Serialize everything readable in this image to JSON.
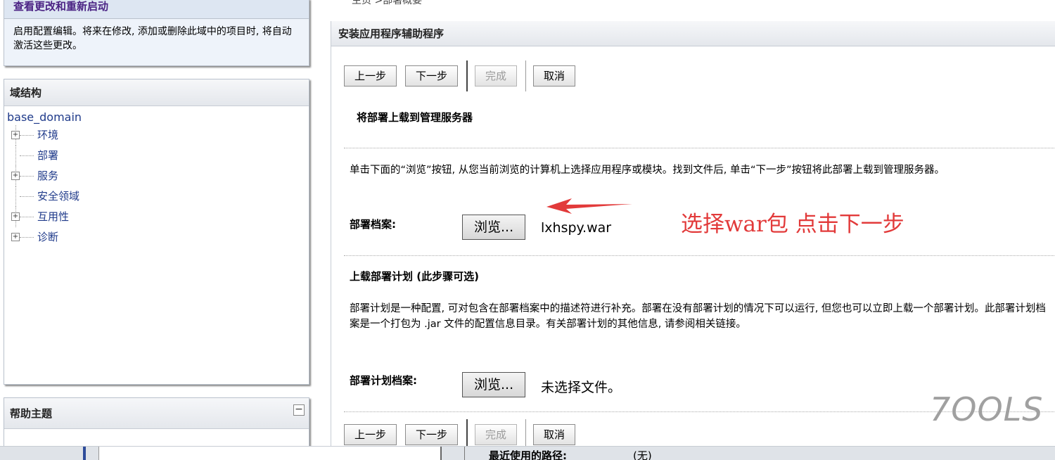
{
  "changes_panel": {
    "title": "查看更改和重新启动",
    "body": "启用配置编辑。将来在修改, 添加或删除此域中的项目时, 将自动激活这些更改。"
  },
  "domain_structure": {
    "title": "域结构",
    "root": "base_domain",
    "items": [
      {
        "label": "环境",
        "expandable": true
      },
      {
        "label": "部署",
        "expandable": false
      },
      {
        "label": "服务",
        "expandable": true
      },
      {
        "label": "安全领域",
        "expandable": false
      },
      {
        "label": "互用性",
        "expandable": true
      },
      {
        "label": "诊断",
        "expandable": true
      }
    ]
  },
  "help_panel": {
    "title": "帮助主题",
    "collapse_symbol": "−"
  },
  "breadcrumb": "主页 >部署概要",
  "main": {
    "title": "安装应用程序辅助程序",
    "buttons": {
      "back": "上一步",
      "next": "下一步",
      "finish": "完成",
      "cancel": "取消"
    },
    "upload_section_title": "将部署上载到管理服务器",
    "upload_instructions": "单击下面的“浏览”按钮, 从您当前浏览的计算机上选择应用程序或模块。找到文件后, 单击“下一步”按钮将此部署上载到管理服务器。",
    "archive_label": "部署档案:",
    "browse_label": "浏览...",
    "archive_file": "lxhspy.war",
    "annotation": "选择war包 点击下一步",
    "plan_section_title": "上载部署计划 (此步骤可选)",
    "plan_instructions": "部署计划是一种配置, 可对包含在部署档案中的描述符进行补充。部署在没有部署计划的情况下可以运行, 但您也可以立即上载一个部署计划。此部署计划档案是一个打包为 .jar 文件的配置信息目录。有关部署计划的其他信息, 请参阅相关链接。",
    "plan_label": "部署计划档案:",
    "plan_file": "未选择文件。"
  },
  "bottom": {
    "recent_label": "最近使用的路径:",
    "recent_value": "(无)"
  },
  "watermark": "7OOLS",
  "colors": {
    "accent_purple": "#4b2384",
    "link_blue": "#1f3a8a",
    "annotation_red": "#e23a3a"
  }
}
